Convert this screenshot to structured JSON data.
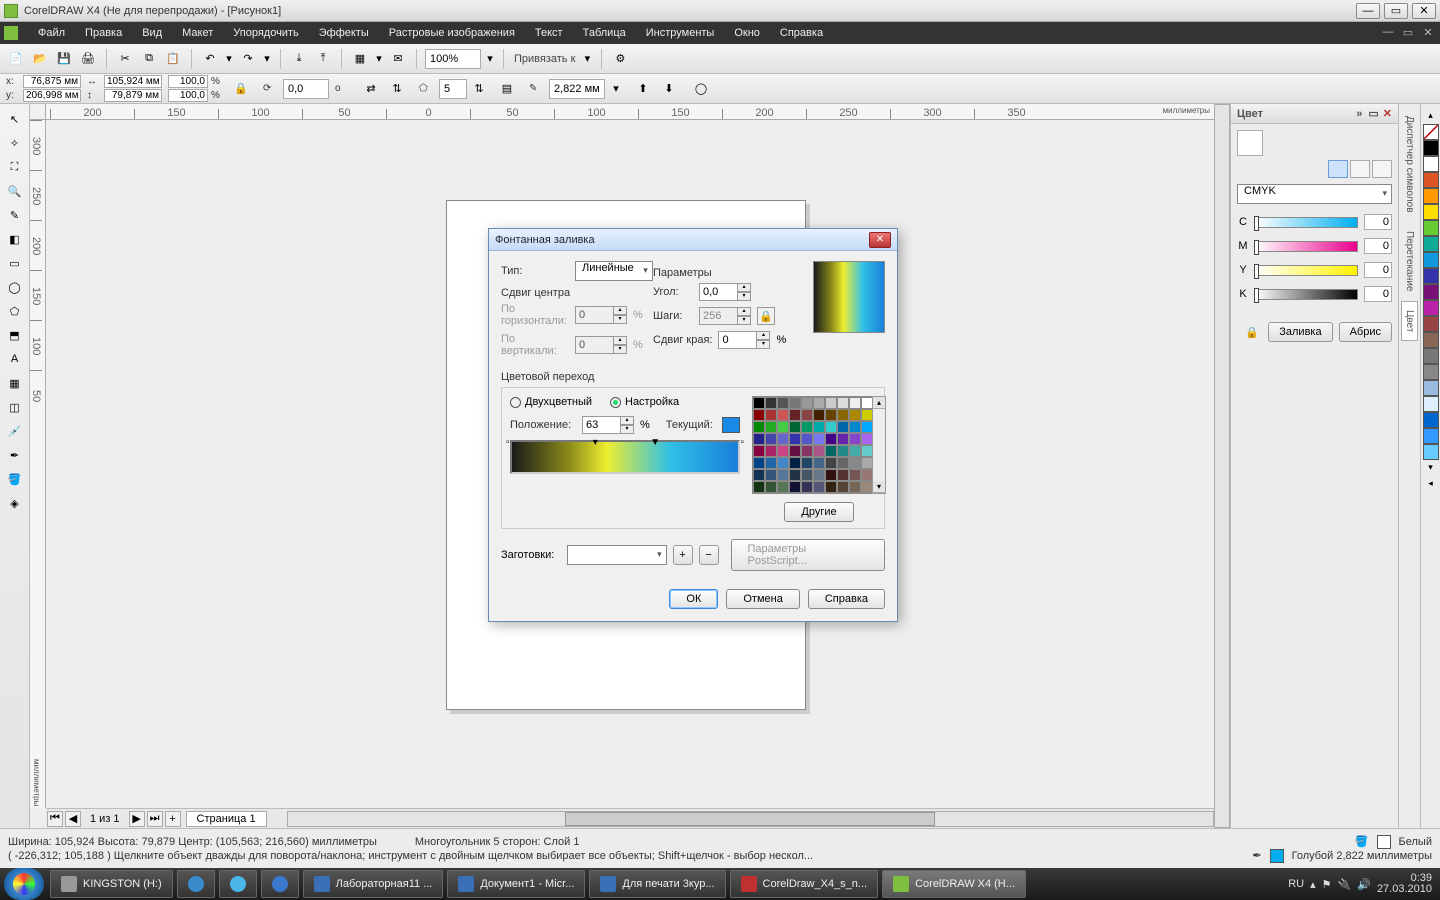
{
  "title": "CorelDRAW X4 (Не для перепродажи) - [Рисунок1]",
  "menu": [
    "Файл",
    "Правка",
    "Вид",
    "Макет",
    "Упорядочить",
    "Эффекты",
    "Растровые изображения",
    "Текст",
    "Таблица",
    "Инструменты",
    "Окно",
    "Справка"
  ],
  "toolbar": {
    "zoom": "100%",
    "snap_label": "Привязать к"
  },
  "property_bar": {
    "x_label": "x:",
    "x": "76,875 мм",
    "y_label": "y:",
    "y": "206,998 мм",
    "w": "105,924 мм",
    "h": "79,879 мм",
    "sx": "100,0",
    "sy": "100,0",
    "percent": "%",
    "angle": "0,0",
    "angle_unit": "o",
    "sides": "5",
    "outline": "2,822 мм"
  },
  "ruler": {
    "h_ticks": [
      "200",
      "150",
      "100",
      "50",
      "0",
      "50",
      "100",
      "150",
      "200",
      "250",
      "300",
      "350"
    ],
    "v_ticks": [
      "300",
      "250",
      "200",
      "150",
      "100",
      "50"
    ],
    "unit": "миллиметры"
  },
  "page_nav": {
    "counter": "1 из 1",
    "tab": "Страница 1"
  },
  "docker": {
    "title": "Цвет",
    "model": "CMYK",
    "channels": [
      {
        "ch": "C",
        "val": "0",
        "grad": "linear-gradient(90deg,#fff,#00aeef)"
      },
      {
        "ch": "M",
        "val": "0",
        "grad": "linear-gradient(90deg,#fff,#ec008c)"
      },
      {
        "ch": "Y",
        "val": "0",
        "grad": "linear-gradient(90deg,#fff,#fff200)"
      },
      {
        "ch": "K",
        "val": "0",
        "grad": "linear-gradient(90deg,#fff,#000)"
      }
    ],
    "fill_btn": "Заливка",
    "outline_btn": "Абрис",
    "side_tabs": [
      "Диспетчер символов",
      "Перетекание",
      "Цвет"
    ]
  },
  "palette": [
    "#ffffff00",
    "#000",
    "#fff",
    "#d52",
    "#f90",
    "#fd0",
    "#6c3",
    "#1a9",
    "#19d",
    "#33a",
    "#717",
    "#b2a",
    "#944",
    "#865",
    "#777",
    "#888",
    "#9bd",
    "#def",
    "#06c",
    "#39f",
    "#6cf"
  ],
  "status": {
    "line1_left": "Ширина: 105,924  Высота: 79,879  Центр: (105,563; 216,560)  миллиметры",
    "line1_mid": "Многоугольник  5 сторон: Слой 1",
    "line2": "( -226,312; 105,188 )     Щелкните объект дважды для поворота/наклона; инструмент с двойным щелчком выбирает все объекты; Shift+щелчок - выбор нескол...",
    "fill_name": "Белый",
    "outline_name": "Голубой  2,822 миллиметры"
  },
  "taskbar": {
    "items": [
      {
        "label": "KINGSTON (H:)",
        "ico": "#999"
      },
      {
        "label": "",
        "ico": "#3a8acc",
        "round": true
      },
      {
        "label": "",
        "ico": "#4bb7e8",
        "round": true
      },
      {
        "label": "",
        "ico": "#3b78cc",
        "round": true
      },
      {
        "label": "Лабораторная11 ...",
        "ico": "#3b6fb8"
      },
      {
        "label": "Документ1 - Micr...",
        "ico": "#3b6fb8"
      },
      {
        "label": "Для печати 3кур...",
        "ico": "#3b6fb8"
      },
      {
        "label": "CorelDraw_X4_s_n...",
        "ico": "#c03030"
      },
      {
        "label": "CorelDRAW X4 (Н...",
        "ico": "#7fbf3f",
        "active": true
      }
    ],
    "lang": "RU",
    "time": "0:39",
    "date": "27.03.2010"
  },
  "dialog": {
    "title": "Фонтанная заливка",
    "type_label": "Тип:",
    "type_value": "Линейные",
    "center_shift": "Сдвиг центра",
    "horiz": "По горизонтали:",
    "vert": "По вертикали:",
    "hv_val": "0",
    "params": "Параметры",
    "angle_label": "Угол:",
    "angle_val": "0,0",
    "steps_label": "Шаги:",
    "steps_val": "256",
    "edge_label": "Сдвиг края:",
    "edge_val": "0",
    "pct": "%",
    "color_trans": "Цветовой переход",
    "two_color": "Двухцветный",
    "custom": "Настройка",
    "position_label": "Положение:",
    "position_val": "63",
    "current_label": "Текущий:",
    "others_btn": "Другие",
    "presets_label": "Заготовки:",
    "ps_params": "Параметры PostScript...",
    "ok": "ОК",
    "cancel": "Отмена",
    "help": "Справка"
  }
}
